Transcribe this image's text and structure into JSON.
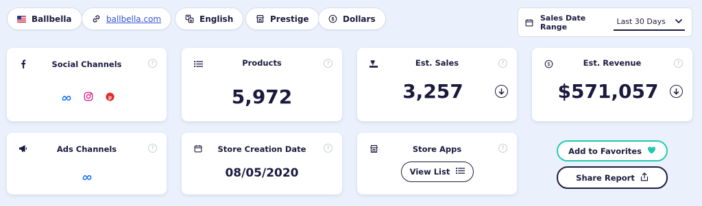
{
  "top_bar": {
    "store_name": "Ballbella",
    "store_url": "ballbella.com",
    "language": "English",
    "theme": "Prestige",
    "currency": "Dollars"
  },
  "date_range": {
    "label": "Sales Date Range",
    "selected": "Last 30 Days"
  },
  "cards": {
    "social_channels": {
      "title": "Social Channels",
      "icons": [
        "meta-icon",
        "instagram-icon",
        "pinterest-icon"
      ]
    },
    "products": {
      "title": "Products",
      "value": "5,972"
    },
    "est_sales": {
      "title": "Est. Sales",
      "value": "3,257"
    },
    "est_revenue": {
      "title": "Est. Revenue",
      "value": "$571,057"
    },
    "ads_channels": {
      "title": "Ads Channels",
      "icons": [
        "meta-icon"
      ]
    },
    "store_creation": {
      "title": "Store Creation Date",
      "value": "08/05/2020"
    },
    "store_apps": {
      "title": "Store Apps",
      "button": "View List"
    }
  },
  "actions": {
    "favorites": "Add to Favorites",
    "share": "Share Report"
  },
  "colors": {
    "background": "#eaf1fc",
    "text": "#1b1a3e",
    "link": "#2f52d9",
    "favorite_accent": "#22c9b3",
    "meta": "#1877f2",
    "instagram": "#d6298a",
    "pinterest": "#e02b2b"
  }
}
